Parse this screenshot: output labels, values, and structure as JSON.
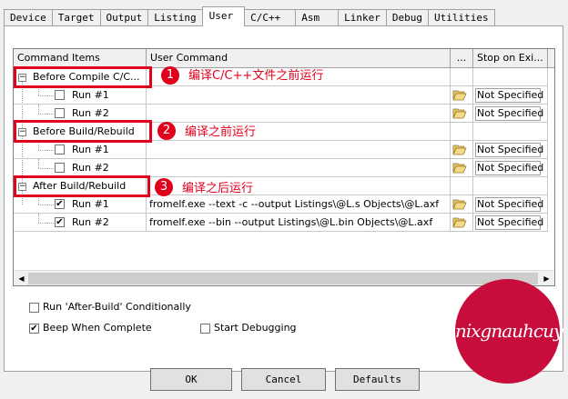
{
  "tabs": [
    {
      "label": "Device"
    },
    {
      "label": "Target"
    },
    {
      "label": "Output"
    },
    {
      "label": "Listing"
    },
    {
      "label": "User",
      "active": true
    },
    {
      "label": "C/C++"
    },
    {
      "label": "Asm"
    },
    {
      "label": "Linker"
    },
    {
      "label": "Debug"
    },
    {
      "label": "Utilities"
    }
  ],
  "grid": {
    "headers": {
      "command_items": "Command Items",
      "user_command": "User Command",
      "browse": "...",
      "stop": "Stop on Exi..."
    },
    "groups": [
      {
        "label": "Before Compile C/C...",
        "runs": [
          {
            "label": "Run #1",
            "checked": false,
            "command": "",
            "stop": "Not Specified"
          },
          {
            "label": "Run #2",
            "checked": false,
            "command": "",
            "stop": "Not Specified"
          }
        ]
      },
      {
        "label": "Before Build/Rebuild",
        "runs": [
          {
            "label": "Run #1",
            "checked": false,
            "command": "",
            "stop": "Not Specified"
          },
          {
            "label": "Run #2",
            "checked": false,
            "command": "",
            "stop": "Not Specified"
          }
        ]
      },
      {
        "label": "After Build/Rebuild",
        "runs": [
          {
            "label": "Run #1",
            "checked": true,
            "command": "fromelf.exe --text -c --output Listings\\@L.s   Objects\\@L.axf",
            "stop": "Not Specified"
          },
          {
            "label": "Run #2",
            "checked": true,
            "command": "fromelf.exe --bin --output Listings\\@L.bin Objects\\@L.axf",
            "stop": "Not Specified"
          }
        ]
      }
    ]
  },
  "options": {
    "run_after_build": {
      "label": "Run 'After-Build' Conditionally",
      "checked": false
    },
    "beep": {
      "label": "Beep When Complete",
      "checked": true
    },
    "start_debugging": {
      "label": "Start Debugging",
      "checked": false
    }
  },
  "buttons": {
    "ok": "OK",
    "cancel": "Cancel",
    "defaults": "Defaults"
  },
  "annotations": [
    {
      "number": "1",
      "text": "编译C/C++文件之前运行"
    },
    {
      "number": "2",
      "text": "编译之前运行"
    },
    {
      "number": "3",
      "text": "编译之后运行"
    }
  ],
  "watermark": "nixgnauhcuy",
  "colors": {
    "annotation_red": "#e0001b",
    "watermark_bg": "#c80d3c"
  }
}
